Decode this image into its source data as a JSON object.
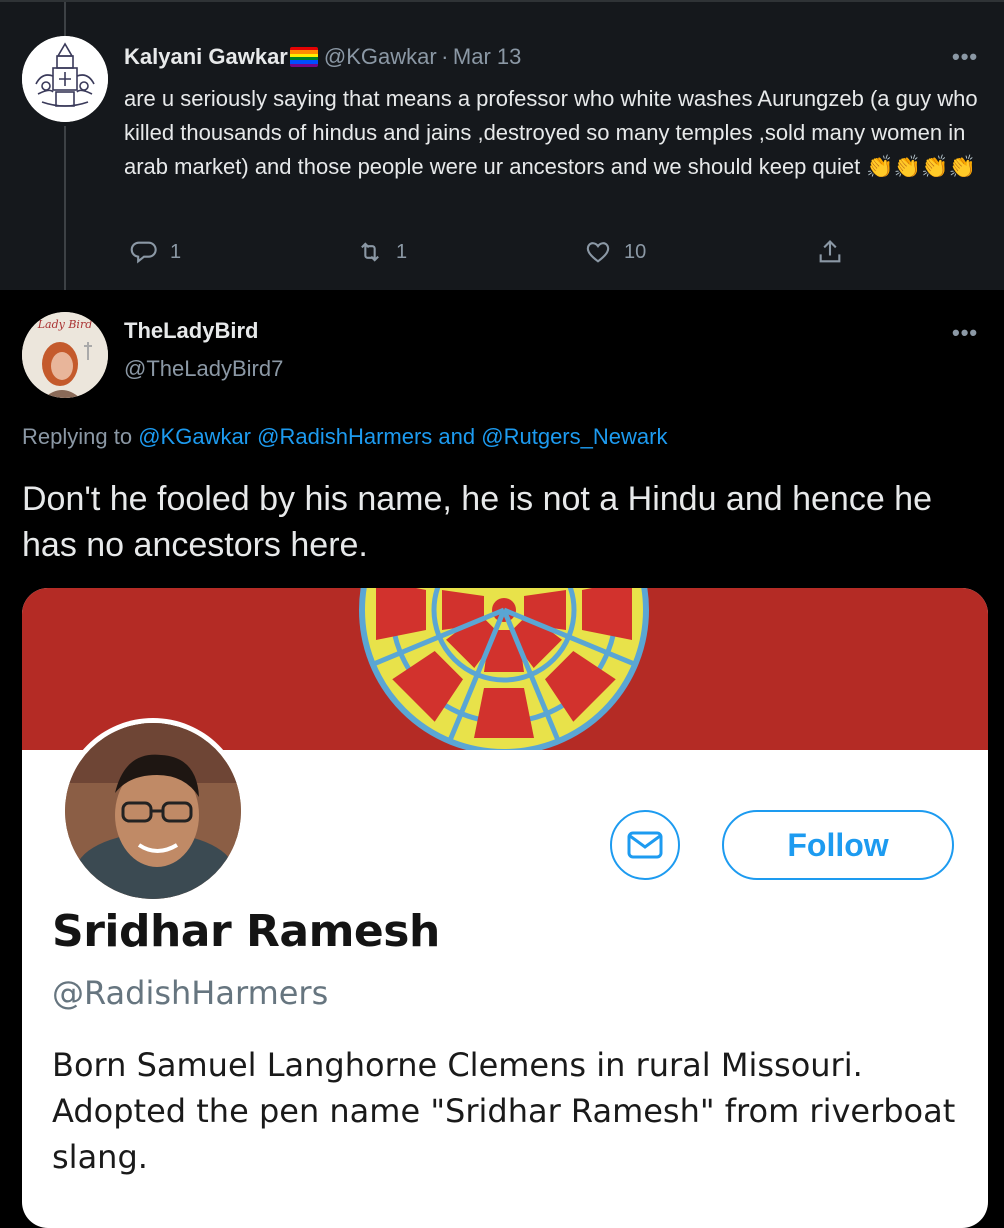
{
  "tweet1": {
    "author_name": "Kalyani Gawkar",
    "author_handle": "@KGawkar",
    "separator": "·",
    "date": "Mar 13",
    "text": "are u seriously saying that means a professor who white washes Aurungzeb (a guy who killed thousands of hindus and jains ,destroyed so many temples ,sold many women in arab market) and those people were ur ancestors and we should keep quiet",
    "emoji": "👏👏👏👏",
    "replies": "1",
    "retweets": "1",
    "likes": "10",
    "more": "•••"
  },
  "tweet2": {
    "author_name": "TheLadyBird",
    "author_handle": "@TheLadyBird7",
    "more": "•••",
    "avatar_text": "Lady Bird",
    "replying_prefix": "Replying to",
    "replying_to_1": "@KGawkar",
    "replying_to_2": "@RadishHarmers",
    "replying_and": "and",
    "replying_to_3": "@Rutgers_Newark",
    "text": "Don't he fooled by his name, he is not a Hindu and hence he has no ancestors here."
  },
  "profile_card": {
    "name": "Sridhar Ramesh",
    "handle": "@RadishHarmers",
    "follow_label": "Follow",
    "bio": "Born Samuel Langhorne Clemens in rural Missouri. Adopted the pen name \"Sridhar Ramesh\" from riverboat slang."
  },
  "colors": {
    "accent": "#1d9bf0",
    "banner": "#b42b25",
    "tweet1_bg": "#15181c"
  },
  "icons": [
    "reply-icon",
    "retweet-icon",
    "like-icon",
    "share-icon",
    "mail-icon",
    "pride-flag-icon"
  ]
}
